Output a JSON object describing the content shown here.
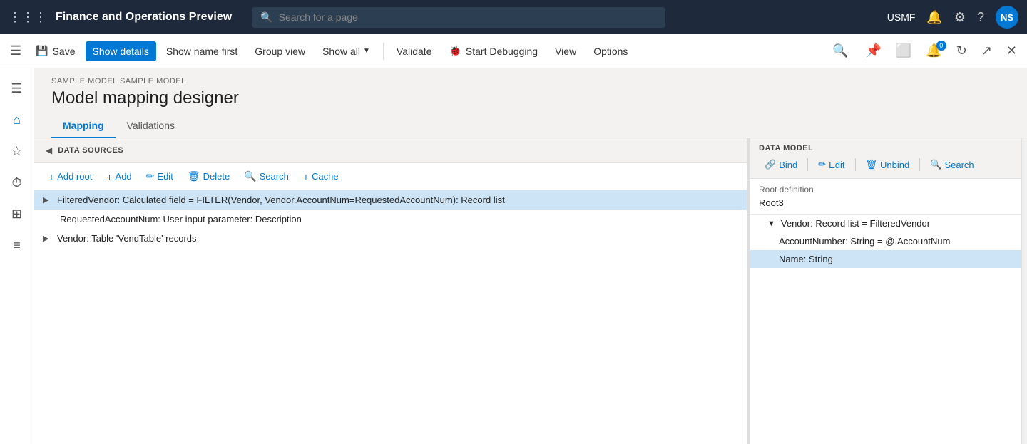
{
  "app": {
    "title": "Finance and Operations Preview",
    "search_placeholder": "Search for a page",
    "user": "USMF",
    "avatar": "NS"
  },
  "cmdbar": {
    "save_label": "Save",
    "show_details_label": "Show details",
    "show_name_first_label": "Show name first",
    "group_view_label": "Group view",
    "show_all_label": "Show all",
    "validate_label": "Validate",
    "start_debugging_label": "Start Debugging",
    "view_label": "View",
    "options_label": "Options",
    "notification_badge": "0"
  },
  "page": {
    "breadcrumb": "SAMPLE MODEL SAMPLE MODEL",
    "title": "Model mapping designer"
  },
  "tabs": [
    {
      "id": "mapping",
      "label": "Mapping",
      "active": true
    },
    {
      "id": "validations",
      "label": "Validations",
      "active": false
    }
  ],
  "data_sources": {
    "panel_title": "DATA SOURCES",
    "toolbar": {
      "add_root": "Add root",
      "add": "Add",
      "edit": "Edit",
      "delete": "Delete",
      "search": "Search",
      "cache": "Cache"
    },
    "items": [
      {
        "id": "filtered-vendor",
        "text": "FilteredVendor: Calculated field = FILTER(Vendor, Vendor.AccountNum=RequestedAccountNum): Record list",
        "level": 0,
        "expandable": true,
        "selected": true
      },
      {
        "id": "requested-account",
        "text": "RequestedAccountNum: User input parameter: Description",
        "level": 1,
        "expandable": false,
        "selected": false
      },
      {
        "id": "vendor",
        "text": "Vendor: Table 'VendTable' records",
        "level": 0,
        "expandable": true,
        "selected": false
      }
    ]
  },
  "data_model": {
    "panel_title": "DATA MODEL",
    "toolbar": {
      "bind": "Bind",
      "edit": "Edit",
      "unbind": "Unbind",
      "search": "Search"
    },
    "root_definition_label": "Root definition",
    "root_value": "Root3",
    "items": [
      {
        "id": "vendor-record",
        "text": "Vendor: Record list = FilteredVendor",
        "level": 1,
        "expandable": true,
        "expanded": true
      },
      {
        "id": "account-number",
        "text": "AccountNumber: String = @.AccountNum",
        "level": 2,
        "expandable": false
      },
      {
        "id": "name-string",
        "text": "Name: String",
        "level": 2,
        "expandable": false,
        "selected": true
      }
    ]
  },
  "sidebar_icons": [
    {
      "id": "menu",
      "symbol": "☰"
    },
    {
      "id": "home",
      "symbol": "⌂"
    },
    {
      "id": "favorites",
      "symbol": "☆"
    },
    {
      "id": "recent",
      "symbol": "⏱"
    },
    {
      "id": "workspaces",
      "symbol": "⊞"
    },
    {
      "id": "list",
      "symbol": "≡"
    }
  ]
}
